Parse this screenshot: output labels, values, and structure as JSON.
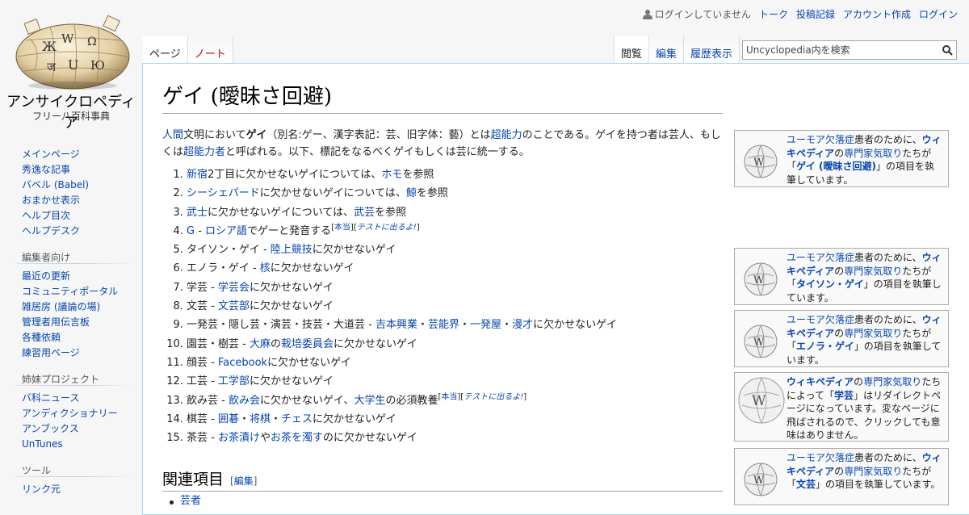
{
  "logo": {
    "title": "アンサイクロペディア",
    "subtitle": "フリー八百科事典"
  },
  "personal": {
    "not_logged_in": "ログインしていません",
    "talk": "トーク",
    "contributions": "投稿記録",
    "create_account": "アカウント作成",
    "login": "ログイン"
  },
  "tabs": {
    "page": "ページ",
    "note": "ノート",
    "view": "閲覧",
    "edit": "編集",
    "history": "履歴表示"
  },
  "search": {
    "placeholder": "Uncyclopedia内を検索"
  },
  "sidebar": {
    "nav": [
      "メインページ",
      "秀逸な記事",
      "バベル (Babel)",
      "おまかせ表示",
      "ヘルプ目次",
      "ヘルプデスク"
    ],
    "editors_heading": "編集者向け",
    "editors": [
      "最近の更新",
      "コミュニティポータル",
      "雑居房 (議論の場)",
      "管理者用伝言板",
      "各種依頼",
      "練習用ページ"
    ],
    "sister_heading": "姉妹プロジェクト",
    "sister": [
      "バ科ニュース",
      "アンディクショナリー",
      "アンブックス",
      "UnTunes"
    ],
    "tools_heading": "ツール",
    "tools": [
      "リンク元"
    ]
  },
  "article": {
    "title": "ゲイ (曖昧さ回避)",
    "intro": {
      "human": "人間",
      "t1": "文明において",
      "gay": "ゲイ",
      "t2": "（別名:ゲー、漢字表記：芸、旧字体：藝）とは",
      "superpower": "超能力",
      "t3": "のことである。ゲイを持つ者は芸人、もしくは",
      "superhuman": "超能力者",
      "t4": "と呼ばれる。以下、標記をなるべくゲイもしくは芸に統一する。"
    },
    "cite1": "本当",
    "cite2": "テストに出るよ!",
    "items": [
      {
        "a": "新宿",
        "b": "2丁目に欠かせないゲイについては、",
        "c": "ホモ",
        "d": "を参照"
      },
      {
        "a": "シーシェパード",
        "b": "に欠かせないゲイについては、",
        "c": "鯨",
        "d": "を参照"
      },
      {
        "a": "武士",
        "b": "に欠かせないゲイについては、",
        "c": "武芸",
        "d": "を参照"
      },
      {
        "a": "G",
        "b": " - ",
        "c": "ロシア語",
        "d": "でゲーと発音する"
      },
      {
        "a": "タイソン・ゲイ - ",
        "b": "陸上競技",
        "c": "に欠かせないゲイ"
      },
      {
        "a": "エノラ・ゲイ - ",
        "b": "核",
        "c": "に欠かせないゲイ"
      },
      {
        "a": "学芸 - ",
        "b": "学芸会",
        "c": "に欠かせないゲイ"
      },
      {
        "a": "文芸 - ",
        "b": "文芸部",
        "c": "に欠かせないゲイ"
      },
      {
        "a": "一発芸・隠し芸・演芸・技芸・大道芸 - ",
        "b": "吉本興業",
        "c": "・",
        "d": "芸能界",
        "e": "・",
        "f": "一発屋",
        "g": "・",
        "h": "漫才",
        "i": "に欠かせないゲイ"
      },
      {
        "a": "園芸・樹芸 - ",
        "b": "大麻",
        "c": "の",
        "d": "栽培委員会",
        "e": "に欠かせないゲイ"
      },
      {
        "a": "顔芸 - ",
        "b": "Facebook",
        "c": "に欠かせないゲイ"
      },
      {
        "a": "工芸 - ",
        "b": "工学部",
        "c": "に欠かせないゲイ"
      },
      {
        "a": "飲み芸 - ",
        "b": "飲み会",
        "c": "に欠かせないゲイ、",
        "d": "大学生",
        "e": "の必須教養"
      },
      {
        "a": "棋芸 - ",
        "b": "囲碁",
        "c": "・",
        "d": "将棋",
        "e": "・",
        "f": "チェス",
        "g": "に欠かせないゲイ"
      },
      {
        "a": "茶芸 - ",
        "b": "お茶漬け",
        "c": "や",
        "d": "お茶を濁す",
        "e": "のに欠かせないゲイ"
      }
    ],
    "related_heading": "関連項目",
    "edit_label": "編集",
    "related": [
      "芸者"
    ]
  },
  "notices": {
    "lack": "ユーモア欠落症",
    "for_patients": "患者のために、",
    "wikipedia": "ウィキペディア",
    "no": "の",
    "experts": "専門家気取り",
    "tachi": "たち",
    "ga": "が「",
    "item_tail": "」の項目を執筆しています。",
    "box1": "ゲイ (曖昧さ回避)",
    "box2": "タイソン・ゲイ",
    "box3": "エノラ・ゲイ",
    "box5": "文芸",
    "redirect": {
      "t1": "たちによって「",
      "term": "学芸",
      "t2": "」はリダイレクトページになっています。変なページに飛ばされるので、クリックしても意味はありません。"
    }
  },
  "colors": {
    "link": "#0645ad",
    "redlink": "#ba0000",
    "border": "#a7d7f9"
  }
}
